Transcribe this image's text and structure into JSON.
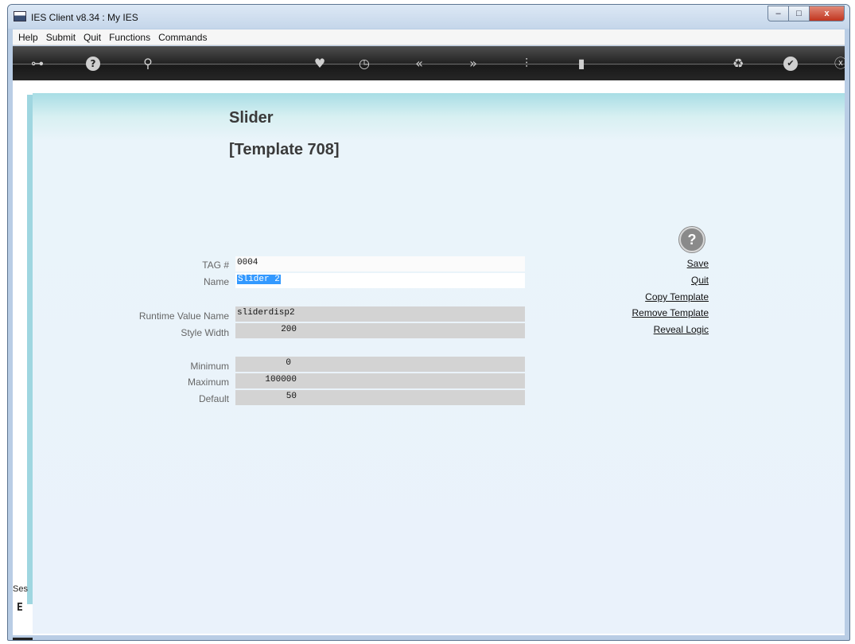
{
  "window": {
    "title": "IES Client v8.34 : My IES",
    "controls": {
      "minimize": "–",
      "maximize": "□",
      "close": "x"
    }
  },
  "menu": [
    "Help",
    "Submit",
    "Quit",
    "Functions",
    "Commands"
  ],
  "toolbar": {
    "icons": [
      "key-icon",
      "help-icon",
      "search-icon",
      "heart-icon",
      "clock-icon",
      "back-icon",
      "forward-icon",
      "tools-icon",
      "document-icon",
      "recycle-icon",
      "check-icon",
      "close-icon"
    ],
    "glyphs": {
      "key": "⊶",
      "help": "?",
      "search": "⚲",
      "heart": "♥",
      "clock": "◷",
      "back": "«",
      "forward": "»",
      "tools": "⫶",
      "document": "▮",
      "recycle": "♻",
      "check": "✔",
      "close": "ⓧ"
    }
  },
  "page": {
    "title": "Slider",
    "subtitle": "[Template 708]"
  },
  "form": {
    "tag": {
      "label": "TAG #",
      "value": "0004"
    },
    "name": {
      "label": "Name",
      "value": "Slider 2"
    },
    "runtime_value_name": {
      "label": "Runtime Value Name",
      "value": "sliderdisp2"
    },
    "style_width": {
      "label": "Style Width",
      "value": "200"
    },
    "minimum": {
      "label": "Minimum",
      "value": "0"
    },
    "maximum": {
      "label": "Maximum",
      "value": "100000"
    },
    "default": {
      "label": "Default",
      "value": "50"
    }
  },
  "actions": {
    "help_glyph": "?",
    "save": "Save",
    "quit": "Quit",
    "copy_template": "Copy Template",
    "remove_template": "Remove Template",
    "reveal_logic": "Reveal Logic"
  },
  "sidebar": {
    "label": "Ses",
    "glyph": "E"
  },
  "colors": {
    "selection": "#3399ff",
    "field_grey": "#d3d3d3",
    "sidebar_strip": "#9fd6e0",
    "content_top": "#a8dde5",
    "toolbar": "#1a1a1a"
  }
}
